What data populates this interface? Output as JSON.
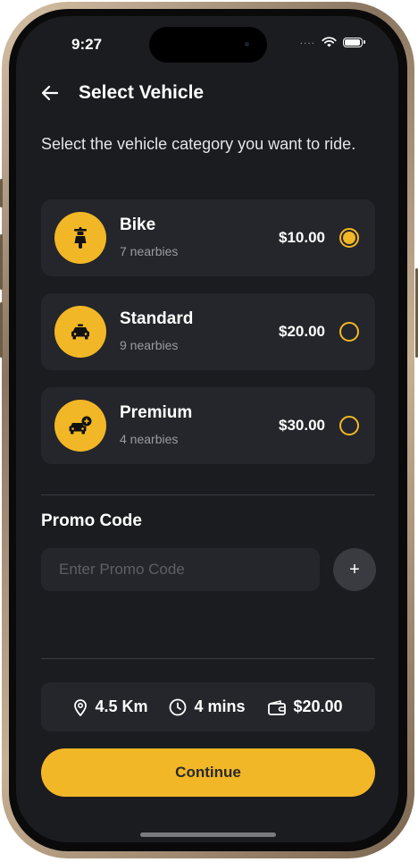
{
  "status_bar": {
    "time": "9:27"
  },
  "header": {
    "title": "Select Vehicle"
  },
  "subtitle": "Select the vehicle category you want to ride.",
  "vehicles": [
    {
      "name": "Bike",
      "nearby": "7 nearbies",
      "price": "$10.00",
      "icon": "scooter-icon",
      "selected": true
    },
    {
      "name": "Standard",
      "nearby": "9 nearbies",
      "price": "$20.00",
      "icon": "car-icon",
      "selected": false
    },
    {
      "name": "Premium",
      "nearby": "4 nearbies",
      "price": "$30.00",
      "icon": "premium-car-icon",
      "selected": false
    }
  ],
  "promo": {
    "label": "Promo Code",
    "placeholder": "Enter Promo Code",
    "value": "",
    "add_label": "+"
  },
  "summary": {
    "distance": "4.5 Km",
    "duration": "4 mins",
    "fare": "$20.00"
  },
  "continue_label": "Continue",
  "colors": {
    "accent": "#f2b726",
    "background": "#1b1c20",
    "card": "#25262b"
  }
}
